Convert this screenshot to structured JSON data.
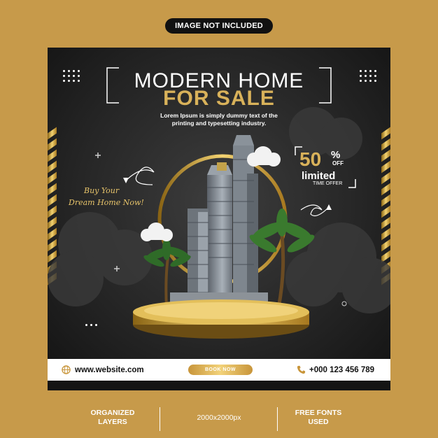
{
  "badge": "IMAGE NOT INCLUDED",
  "title_line1": "MODERN HOME",
  "title_line2": "FOR SALE",
  "subtitle_line1": "Lorem Ipsum is simply dummy text of the",
  "subtitle_line2": "printing and typesetting industry.",
  "script_line1": "Buy Your",
  "script_line2": "Dream Home Now!",
  "offer": {
    "percent": "50",
    "percent_sign": "%",
    "off": "OFF",
    "limited": "limited",
    "time": "TIME OFFER"
  },
  "footer": {
    "website": "www.website.com",
    "book_label": "BOOK NOW",
    "phone": "+000 123 456 789"
  },
  "features": [
    "ORGANIZED\nLAYERS",
    "2000x2000px",
    "FREE FONTS\nUSED"
  ],
  "colors": {
    "background": "#c79a4a",
    "gold": "#d9b25a",
    "dark": "#1a1a1a"
  },
  "icons": [
    "dot-grid-icon",
    "globe-icon",
    "phone-icon",
    "plus-icon",
    "arrow-swirl-icon"
  ]
}
